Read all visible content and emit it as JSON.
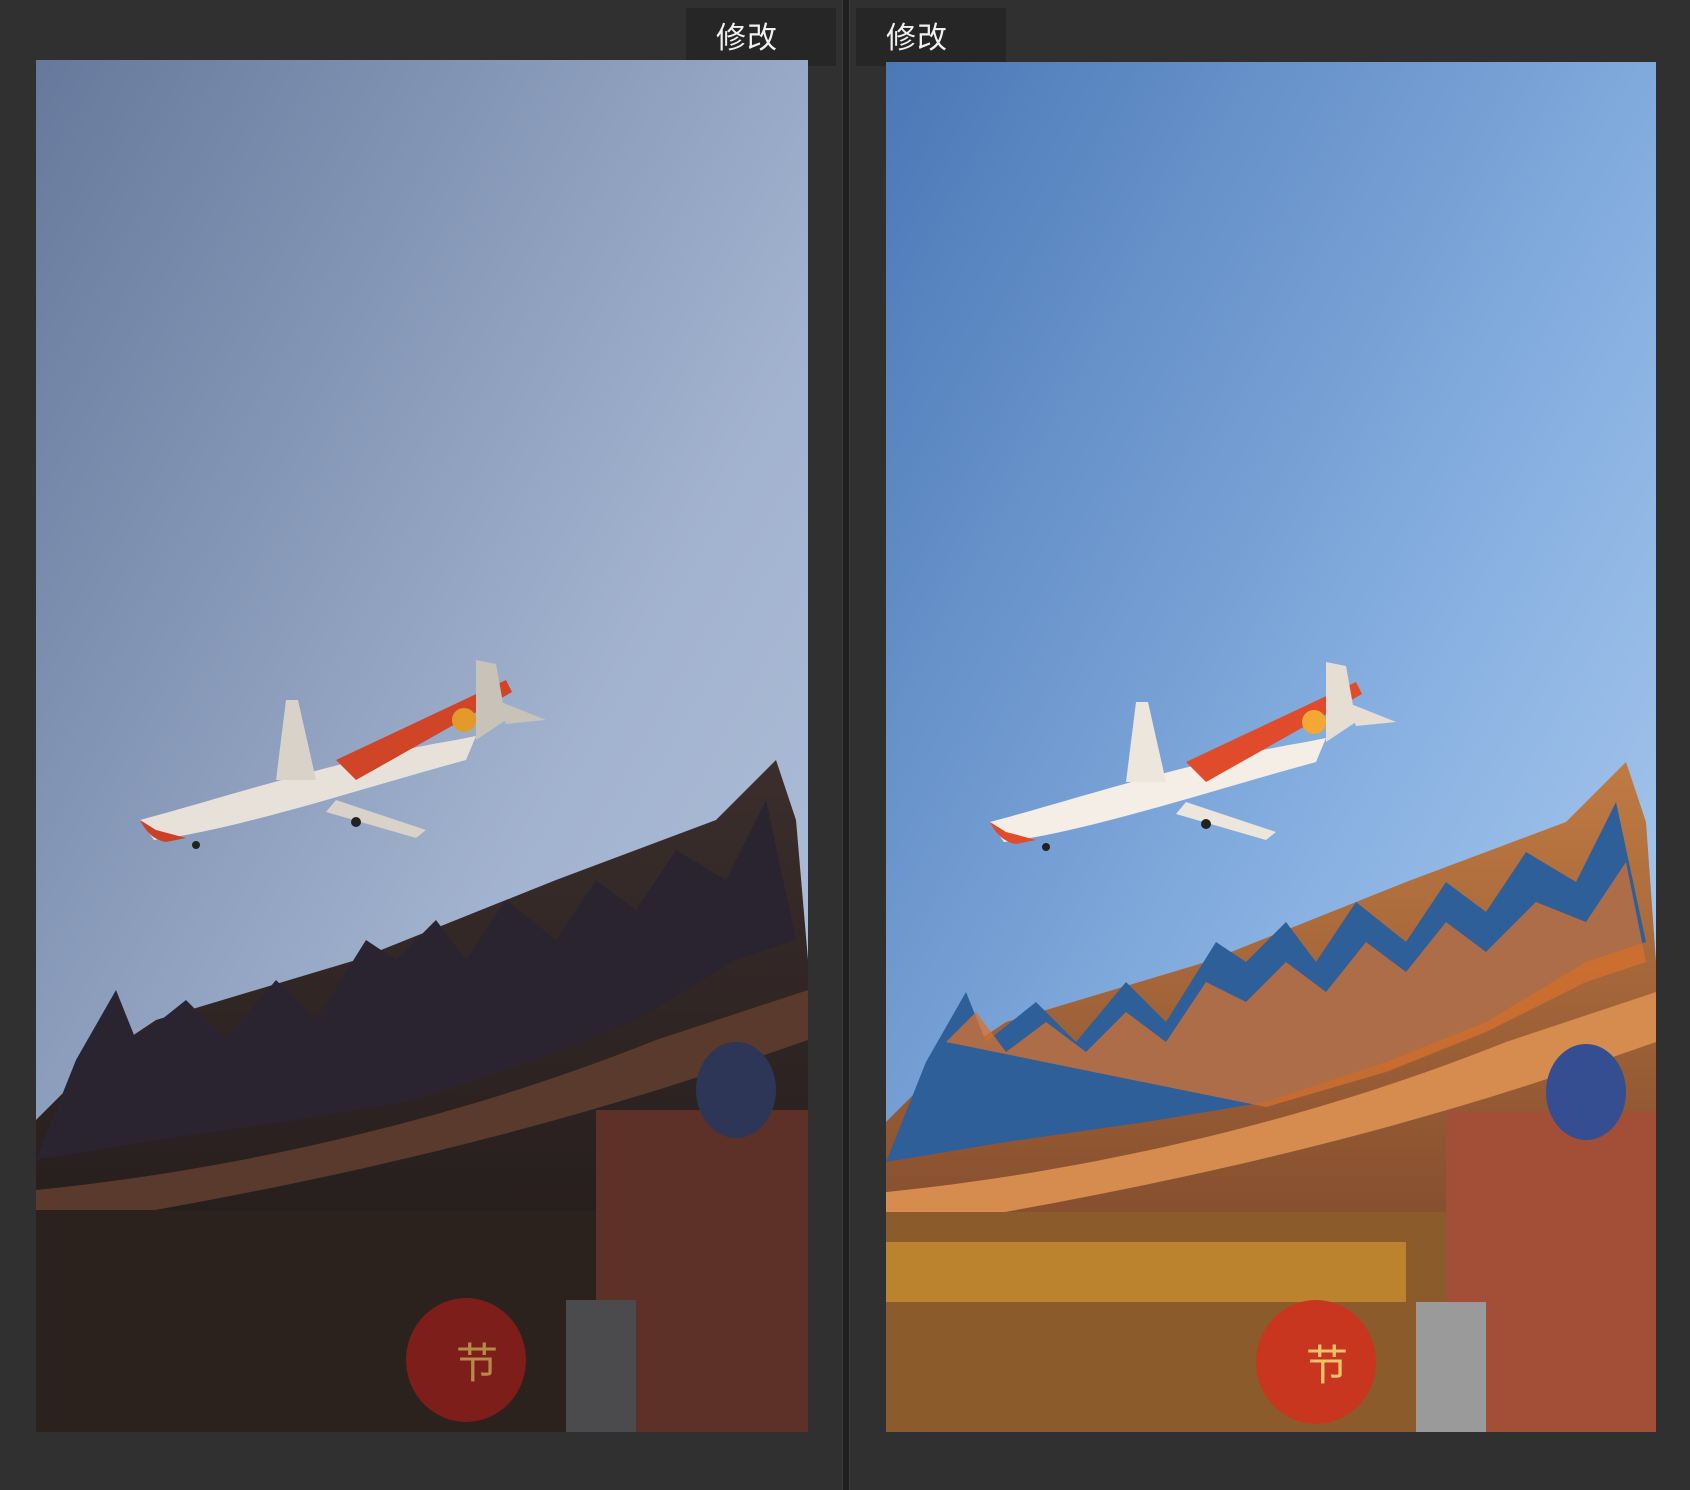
{
  "labels": {
    "before": "修改前",
    "after": "修改后"
  },
  "lantern_text": "节",
  "colors": {
    "background": "#303030",
    "label_bg": "#262626",
    "label_text": "#f1f1f1",
    "before_sky_top": "#6f86a9",
    "before_sky_bottom": "#a9bad6",
    "after_sky_top": "#4f7fbf",
    "after_sky_bottom": "#a9c9ee",
    "plane_red": "#d3452a",
    "lantern_red": "#b7291f"
  }
}
